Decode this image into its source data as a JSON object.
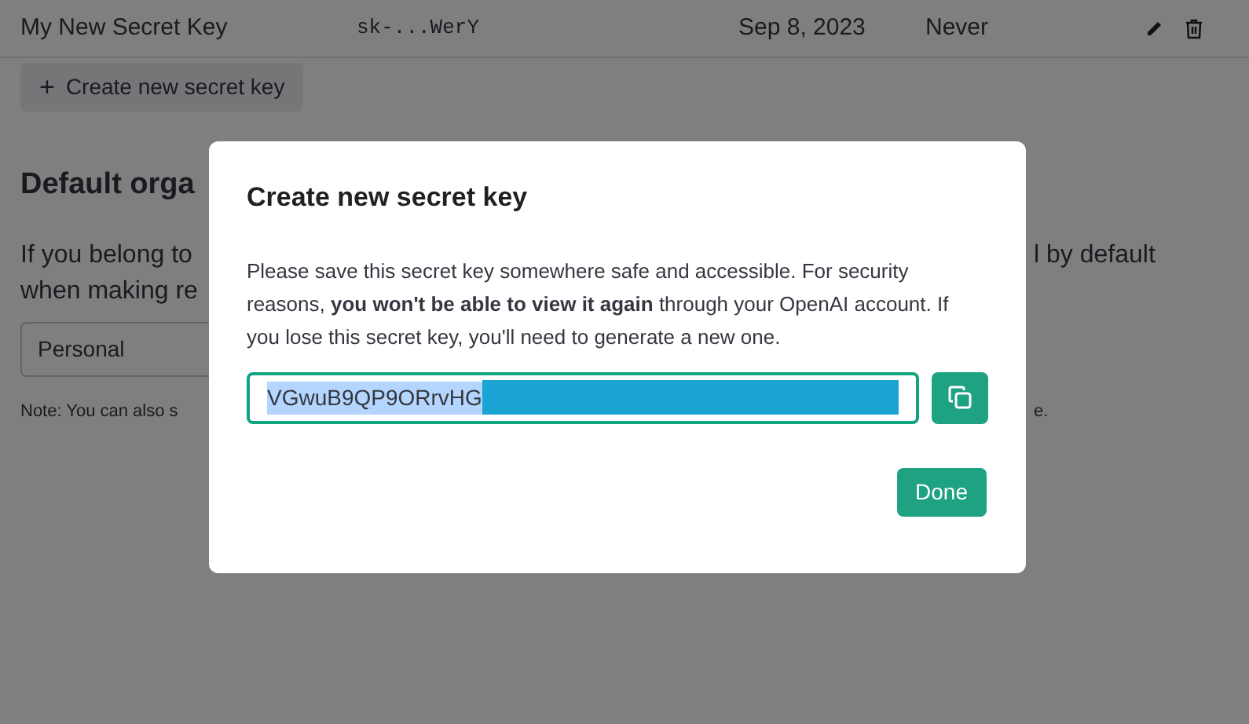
{
  "keys_row": {
    "name": "My New Secret Key",
    "key": "sk-...WerY",
    "created": "Sep 8, 2023",
    "last_used": "Never"
  },
  "create_button": {
    "icon": "+",
    "label": "Create new secret key"
  },
  "default_org": {
    "heading": "Default orga",
    "line_1_left": "If you belong to",
    "line_1_right": "l by default",
    "line_2_left": "when making re",
    "select_value": "Personal",
    "note_left": "Note: You can also s",
    "note_right": "e."
  },
  "dialog": {
    "title": "Create new secret key",
    "message": "Please save this secret key somewhere safe and accessible. For security reasons, **you won't be able to view it again** through your OpenAI account. If you lose this secret key, you'll need to generate a new one.",
    "key_field": {
      "value": "VGwuB9QP9ORrvHG",
      "selected": true
    },
    "done_button": "Done"
  }
}
